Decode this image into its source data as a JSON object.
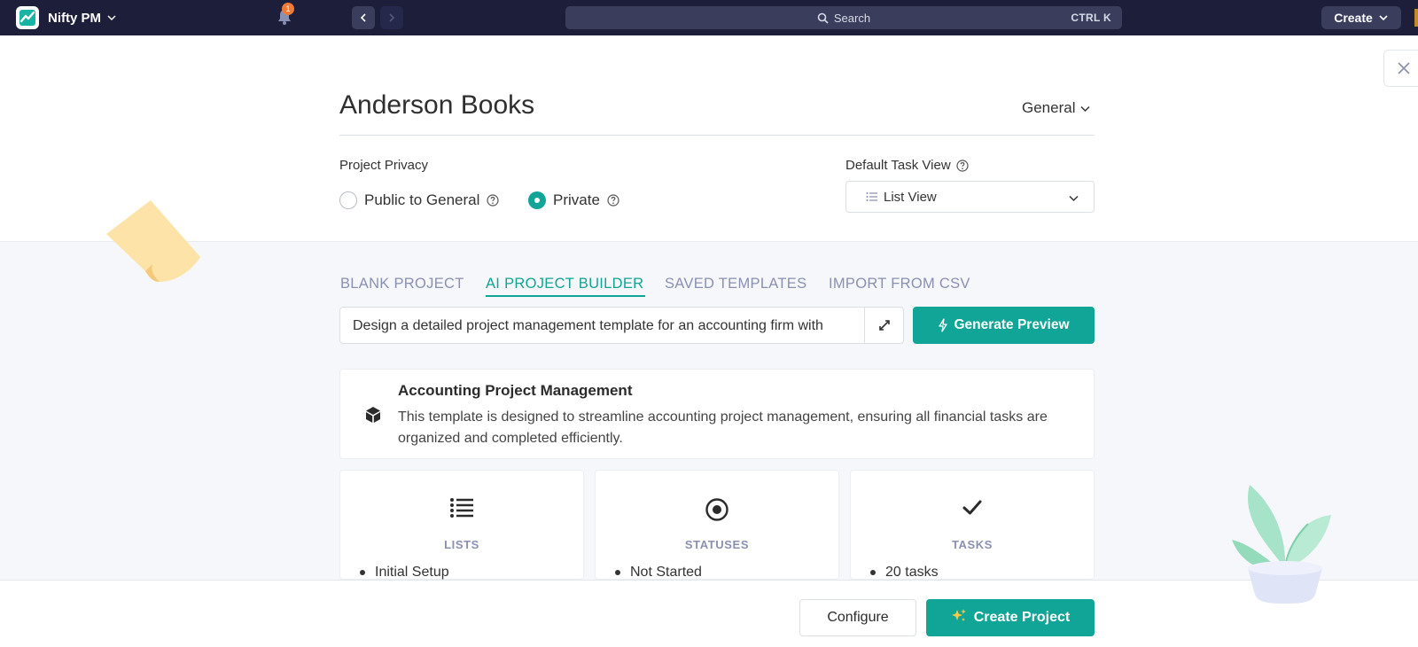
{
  "topbar": {
    "brand_name": "Nifty PM",
    "notification_count": "1",
    "search_label": "Search",
    "search_shortcut": "CTRL K",
    "create_label": "Create"
  },
  "header": {
    "project_name": "Anderson Books",
    "team": "General"
  },
  "privacy": {
    "label": "Project Privacy",
    "options": [
      {
        "label": "Public to General",
        "selected": false
      },
      {
        "label": "Private",
        "selected": true
      }
    ]
  },
  "task_view": {
    "label": "Default Task View",
    "value": "List View"
  },
  "tabs": [
    {
      "label": "BLANK PROJECT",
      "active": false
    },
    {
      "label": "AI PROJECT BUILDER",
      "active": true
    },
    {
      "label": "SAVED TEMPLATES",
      "active": false
    },
    {
      "label": "IMPORT FROM CSV",
      "active": false
    }
  ],
  "prompt": {
    "value": "Design a detailed project management template for an accounting firm with"
  },
  "generate_label": "Generate Preview",
  "template": {
    "title": "Accounting Project Management",
    "description": "This template is designed to streamline accounting project management, ensuring all financial tasks are organized and completed efficiently."
  },
  "stats": [
    {
      "title": "LISTS",
      "icon": "list-icon",
      "first_item": "Initial Setup"
    },
    {
      "title": "STATUSES",
      "icon": "status-icon",
      "first_item": "Not Started"
    },
    {
      "title": "TASKS",
      "icon": "check-icon",
      "first_item": "20 tasks"
    }
  ],
  "footer": {
    "configure_label": "Configure",
    "create_label": "Create Project"
  },
  "colors": {
    "accent": "#10a596",
    "topbar": "#1d1f3a",
    "tab_inactive": "#8a90b2",
    "badge": "#f07a37"
  }
}
